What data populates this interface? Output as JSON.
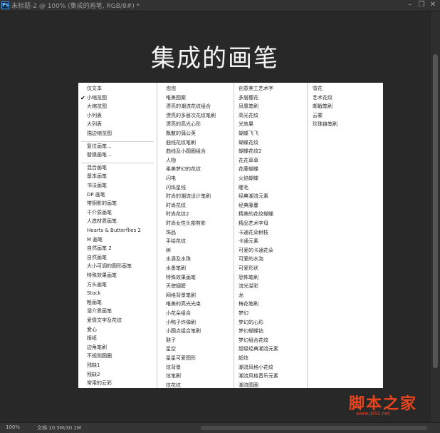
{
  "window": {
    "app_icon_text": "Ps",
    "doc_title": "未标题-2 @ 100% (集成的画笔, RGB/8#) *",
    "minimize": "–",
    "restore": "❐",
    "close": "✕"
  },
  "canvas": {
    "heading": "集成的画笔",
    "menu": {
      "col1": [
        "仅文本",
        "小缩览图",
        "大缩览图",
        "小列表",
        "大列表",
        "描边缩览图",
        "复位画笔...",
        "替换画笔...",
        "混合画笔",
        "基本画笔",
        "书法画笔",
        "DP 画笔",
        "带阴影的画笔",
        "干介质画笔",
        "人造材质画笔",
        "Hearts & Butterflies 2",
        "M 画笔",
        "自然画笔 2",
        "自然画笔",
        "大小可调的圆形画笔",
        "特殊效果画笔",
        "方头画笔",
        "Stock",
        "粗画笔",
        "湿介质画笔",
        "爱情文字及花纹",
        "爱心",
        "报纸",
        "边角笔刷",
        "不规则圆圈",
        "残缺1",
        "残缺2",
        "常用的云彩"
      ],
      "checked_item": "小缩览图",
      "col2": [
        "泡泡",
        "唯美图案",
        "漂亮的潮流花纹组合",
        "漂亮的多层次花纹笔刷",
        "漂亮的高光心形",
        "飘散的蒲公英",
        "曲线花纹笔刷",
        "曲线及小圆圈组合",
        "人物",
        "柔美梦幻的花纹",
        "闪电",
        "闪烁星线",
        "时尚的潮流设计笔刷",
        "时尚花纹",
        "时尚花纹2",
        "时尚女性头部剪影",
        "饰品",
        "手绘花纹",
        "树",
        "水滴及水珠",
        "水墨笔刷",
        "特殊效果画笔",
        "天使翅膀",
        "网格背景笔刷",
        "唯美的高光光束",
        "小花朵组合",
        "小鸭子炸弹刷",
        "小圆点组合笔刷",
        "鞋子",
        "星空",
        "星星可爱图形",
        "炫背景",
        "炫笔刷",
        "炫花纹"
      ],
      "col3": [
        "创意美工艺术字",
        "多层樱花",
        "凤凰笔刷",
        "高光花纹",
        "光效果",
        "蝴蝶飞飞",
        "蝴蝶花纹",
        "蝴蝶花纹2",
        "花花草草",
        "花藤蝴蝶",
        "火焰蝴蝶",
        "睫毛",
        "经典潮流元素",
        "经典藤蔓",
        "精美的花纹蝴蝶",
        "精品艺术字母",
        "卡通花朵树枝",
        "卡通元素",
        "可爱的卡通花朵",
        "可爱的水泡",
        "可爱形状",
        "恐怖笔刷",
        "流光溢彩",
        "龙",
        "梅花笔刷",
        "梦幻",
        "梦幻的心形",
        "梦幻蝴蝶钻",
        "梦幻组合花纹",
        "超级经典潮流元素",
        "超炫",
        "潮流风格小花纹",
        "潮流风格音乐元素",
        "潮流圆圈"
      ],
      "col4": [
        "雪花",
        "艺术花纹",
        "邮戳笔刷",
        "云雾",
        "珍珠链笔刷"
      ]
    }
  },
  "status": {
    "zoom": "100%",
    "doc_info": "文档:10.5M/30.1M"
  },
  "watermark": {
    "brand": "脚本之家",
    "url": "www.jb51.net"
  }
}
